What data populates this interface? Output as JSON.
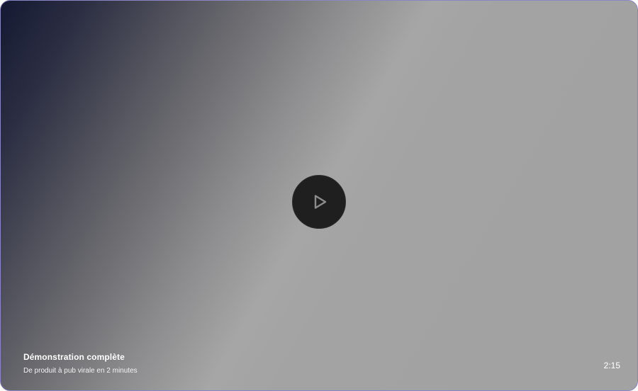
{
  "video": {
    "title": "Démonstration complète",
    "subtitle": "De produit à pub virale en 2 minutes",
    "duration": "2:15",
    "play_icon": "play-icon"
  },
  "colors": {
    "border": "#8a86c4",
    "gradient_dark": "#141831",
    "gradient_light": "#a2a2a2",
    "play_button_bg": "#1f1f1f",
    "play_icon_stroke": "#8c8c8c",
    "text": "#ffffff"
  }
}
